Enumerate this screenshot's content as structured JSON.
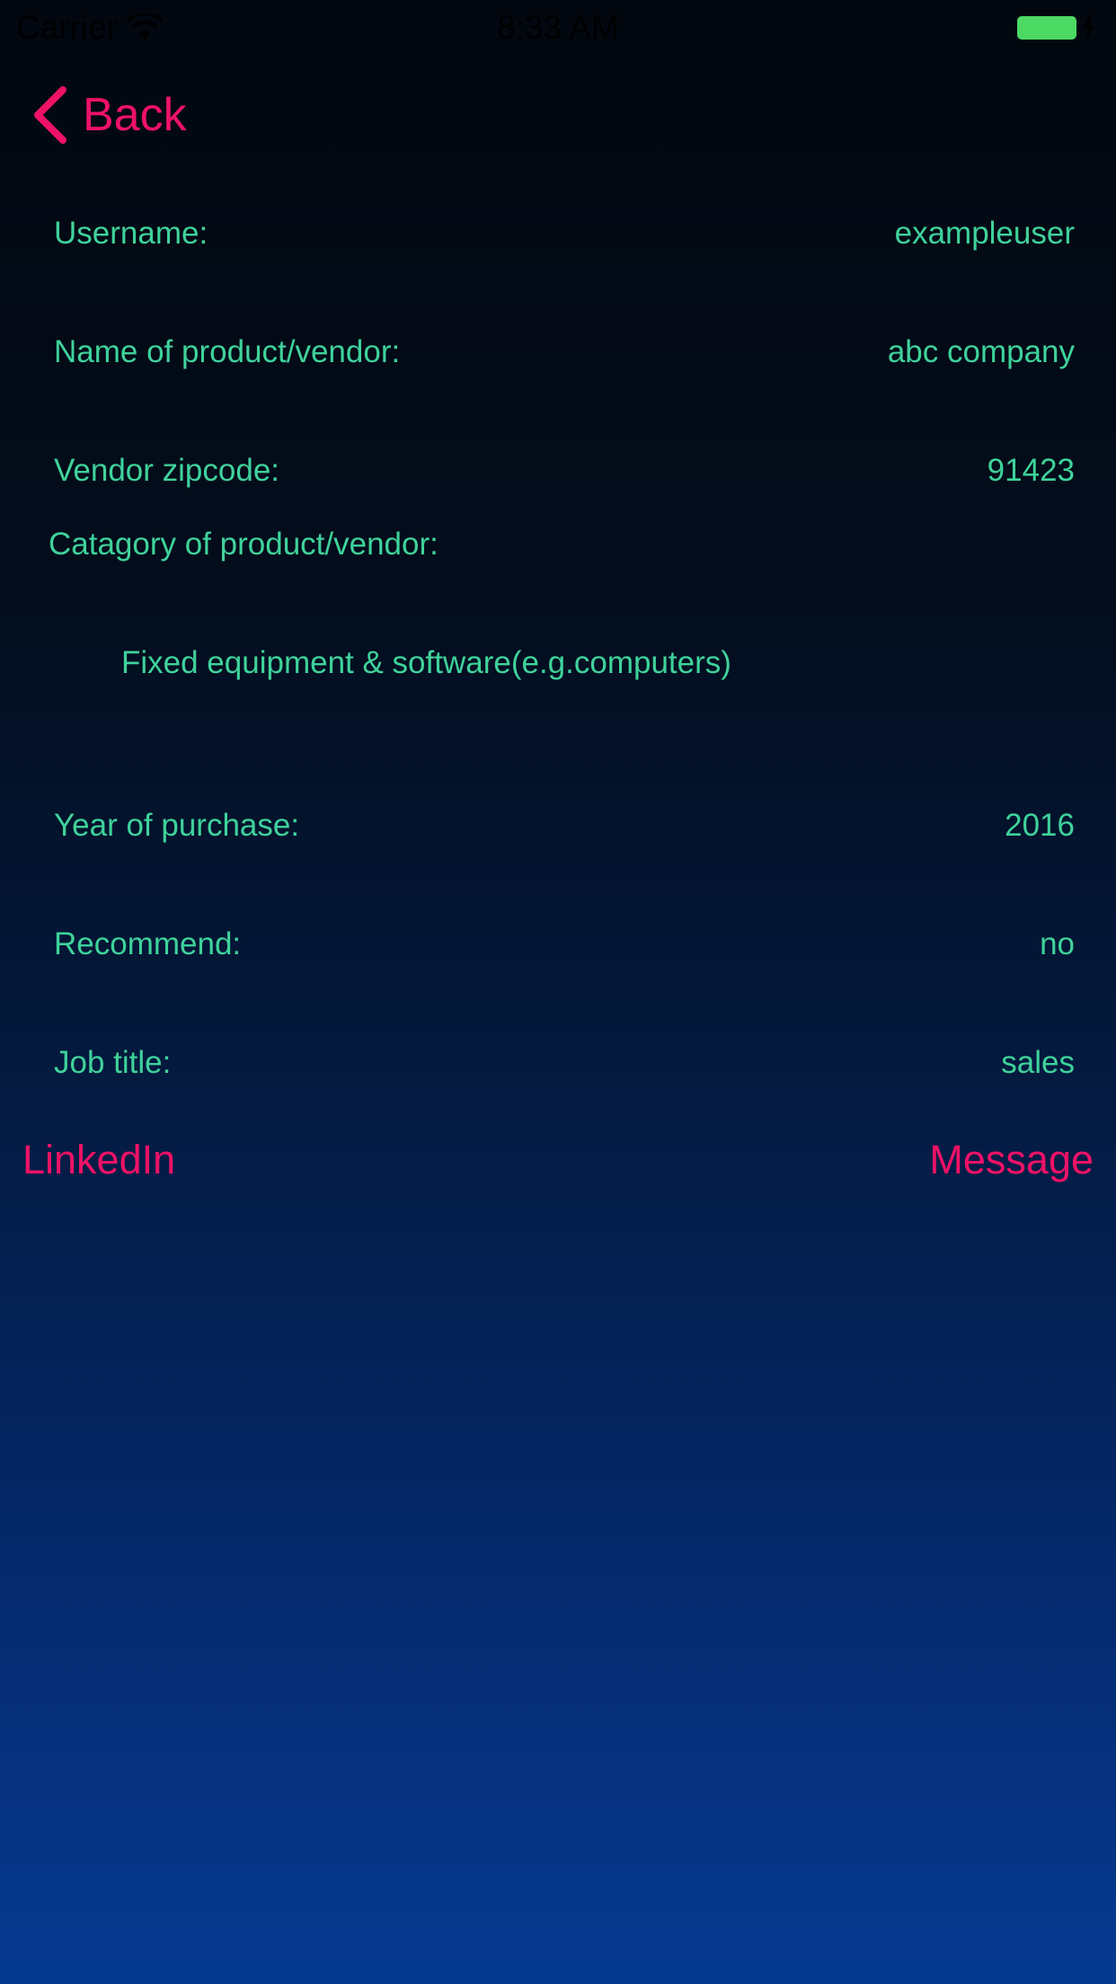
{
  "status_bar": {
    "carrier": "Carrier",
    "time": "8:33 AM",
    "wifi_icon": "wifi-icon",
    "battery_icon": "battery-icon",
    "battery_color": "#4cd964"
  },
  "nav": {
    "back_label": "Back",
    "back_icon": "chevron-left-icon"
  },
  "details": {
    "username_label": "Username:",
    "username_value": "exampleuser",
    "vendor_name_label": "Name of product/vendor:",
    "vendor_name_value": "abc company",
    "zipcode_label": "Vendor zipcode:",
    "zipcode_value": "91423",
    "category_label": "Catagory of  product/vendor:",
    "category_value": "Fixed equipment & software(e.g.computers)",
    "year_label": "Year of purchase:",
    "year_value": "2016",
    "recommend_label": "Recommend:",
    "recommend_value": "no",
    "job_label": "Job title:",
    "job_value": "sales"
  },
  "actions": {
    "linkedin_label": "LinkedIn",
    "message_label": "Message"
  },
  "colors": {
    "accent": "#ee1266",
    "text": "#3fd29b",
    "background_top": "#02070f",
    "background_bottom": "#063a92"
  }
}
